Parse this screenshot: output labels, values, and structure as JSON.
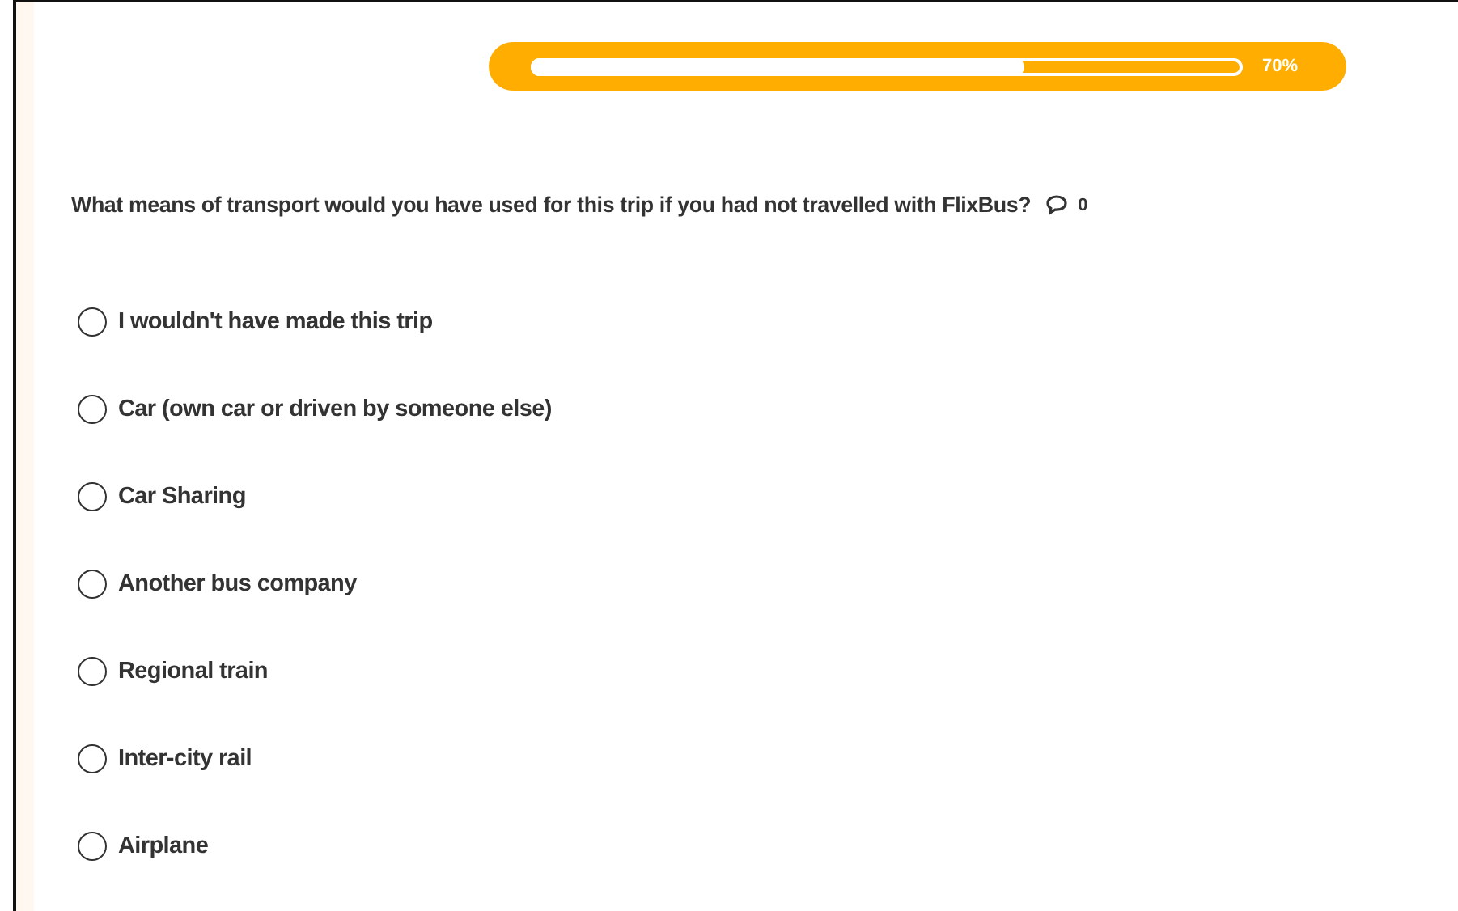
{
  "progress": {
    "level": 0.7,
    "reading": "70%"
  },
  "question": {
    "text": "What means of transport would you have used for this trip if you had not travelled with FlixBus?",
    "comment_count": "0"
  },
  "options": [
    {
      "label": "I wouldn't have made this trip",
      "selected": false
    },
    {
      "label": "Car (own car or driven by someone else)",
      "selected": false
    },
    {
      "label": "Car Sharing",
      "selected": false
    },
    {
      "label": "Another bus company",
      "selected": false
    },
    {
      "label": "Regional train",
      "selected": false
    },
    {
      "label": "Inter-city rail",
      "selected": false
    },
    {
      "label": "Airplane",
      "selected": false
    }
  ]
}
